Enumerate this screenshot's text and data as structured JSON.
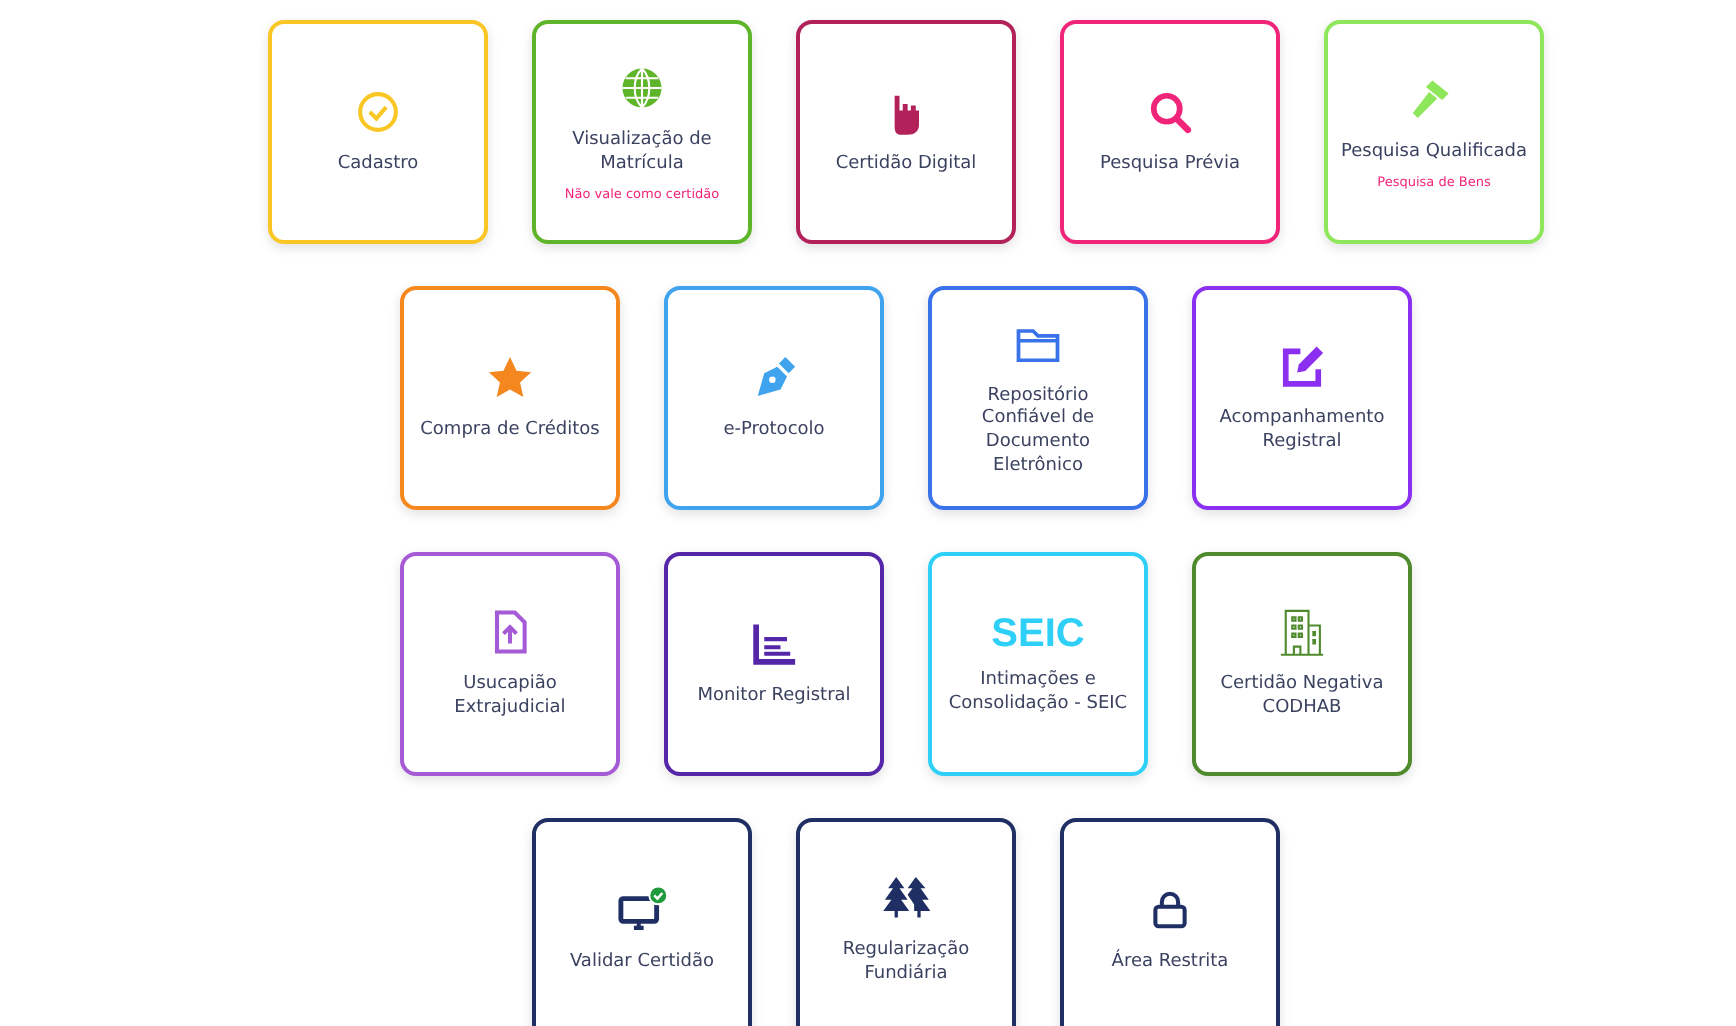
{
  "cards": [
    {
      "label": "Cadastro",
      "color": "#f9c623"
    },
    {
      "label": "Visualização de Matrícula",
      "note": "Não vale como certidão",
      "color": "#5fb52a"
    },
    {
      "label": "Certidão Digital",
      "color": "#b3215a"
    },
    {
      "label": "Pesquisa Prévia",
      "color": "#f0257a"
    },
    {
      "label": "Pesquisa Qualificada",
      "note": "Pesquisa de Bens",
      "color": "#8ee65a"
    },
    {
      "label": "Compra de Créditos",
      "color": "#f5871f"
    },
    {
      "label": "e-Protocolo",
      "color": "#3fa3ee"
    },
    {
      "label": "Repositório Confiável de Documento Eletrônico",
      "color": "#3a72ea"
    },
    {
      "label": "Acompanhamento Registral",
      "color": "#8b2ff0"
    },
    {
      "label": "Usucapião Extrajudicial",
      "color": "#a65bd6"
    },
    {
      "label": "Monitor Registral",
      "color": "#5526a8"
    },
    {
      "label": "Intimações e Consolidação - SEIC",
      "logo": "SEIC",
      "color": "#2fd0f7"
    },
    {
      "label": "Certidão Negativa CODHAB",
      "color": "#4f8a2c"
    },
    {
      "label": "Validar Certidão",
      "color": "#1f2f63"
    },
    {
      "label": "Regularização Fundiária",
      "color": "#1f2f63"
    },
    {
      "label": "Área Restrita",
      "color": "#1f2f63"
    }
  ]
}
